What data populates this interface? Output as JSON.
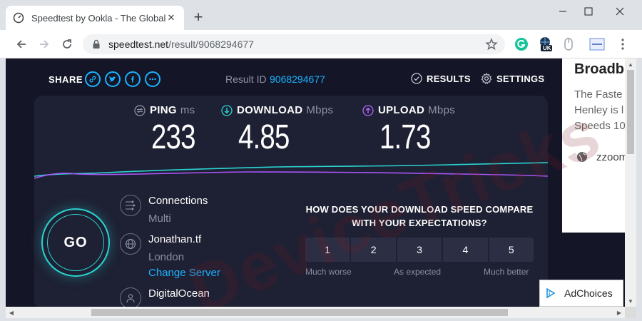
{
  "browser": {
    "tab_title": "Speedtest by Ookla - The Global",
    "url_host": "speedtest.net",
    "url_path": "/result/9068294677",
    "new_tab": "+",
    "ext_badge": "UK"
  },
  "header": {
    "share_label": "SHARE",
    "result_label": "Result ID",
    "result_id": "9068294677",
    "results_label": "RESULTS",
    "settings_label": "SETTINGS"
  },
  "metrics": {
    "ping": {
      "label": "PING",
      "unit": "ms",
      "value": "233"
    },
    "download": {
      "label": "DOWNLOAD",
      "unit": "Mbps",
      "value": "4.85"
    },
    "upload": {
      "label": "UPLOAD",
      "unit": "Mbps",
      "value": "1.73"
    }
  },
  "go_label": "GO",
  "connection": {
    "title": "Connections",
    "mode": "Multi",
    "server_name": "Jonathan.tf",
    "server_city": "London",
    "change_server": "Change Server",
    "provider": "DigitalOcean"
  },
  "compare": {
    "question_line1": "HOW DOES YOUR DOWNLOAD SPEED COMPARE",
    "question_line2": "WITH YOUR EXPECTATIONS?",
    "options": [
      "1",
      "2",
      "3",
      "4",
      "5"
    ],
    "low_label": "Much worse",
    "mid_label": "As expected",
    "high_label": "Much better"
  },
  "ad": {
    "title": "Broadb",
    "line1": "The Faste",
    "line2": "Henley is l",
    "line3": "Speeds 10",
    "domain": "zzoom"
  },
  "adchoices_label": "AdChoices",
  "watermark": "DeviceTricks",
  "colors": {
    "accent": "#1ab3ff",
    "go_ring": "#2ad4d0",
    "download_line": "#2ad4d0",
    "upload_line": "#a855f7",
    "page_bg": "#141526",
    "panel_bg": "#1e2033"
  }
}
